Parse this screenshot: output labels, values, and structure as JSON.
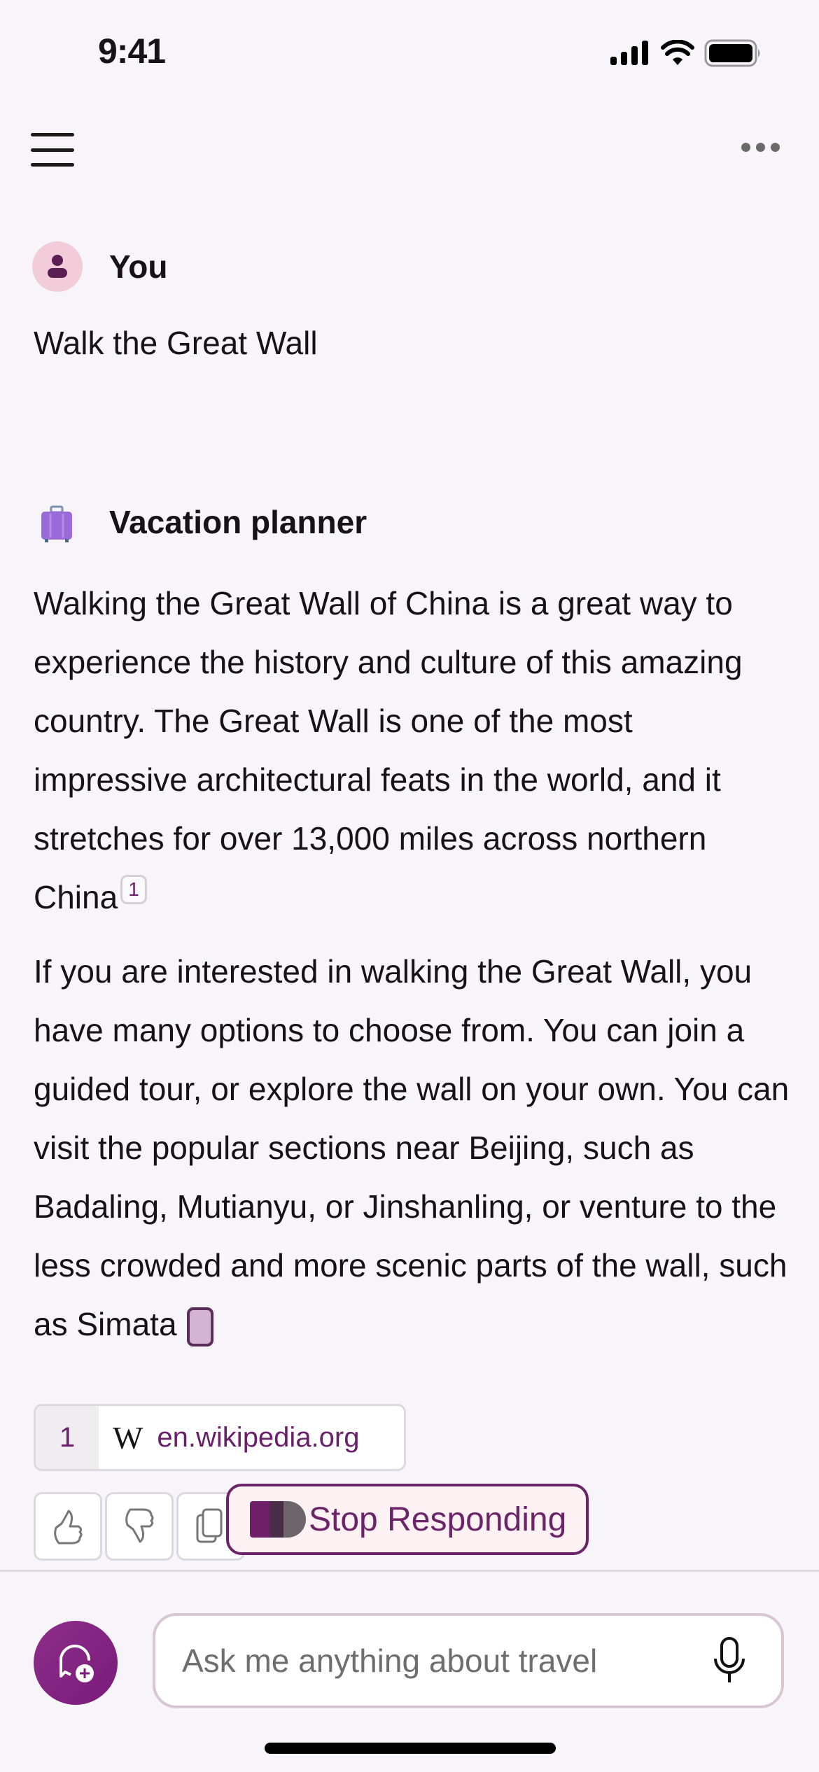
{
  "status_bar": {
    "time": "9:41"
  },
  "header": {
    "menu_icon": "hamburger-menu-icon",
    "more_icon": "more-horizontal-icon"
  },
  "conversation": {
    "user_message": {
      "sender": "You",
      "avatar_icon": "person-icon",
      "text": "Walk the Great Wall"
    },
    "assistant_message": {
      "sender": "Vacation planner",
      "avatar_icon": "suitcase-icon",
      "paragraphs": [
        {
          "text": "Walking the Great Wall of China is a great way to experience the history and culture of this amazing country. The Great Wall is one of the most impressive architectural feats in the world, and it stretches for over 13,000 miles across northern China",
          "citation": "1"
        },
        {
          "text": "If you are interested in walking the Great Wall, you have many options to choose from. You can join a guided tour, or explore the wall on your own. You can visit the popular sections near Beijing, such as Badaling, Mutianyu, or Jinshanling, or venture to the less crowded and more scenic parts of the wall, such as Simata"
        }
      ],
      "sources": [
        {
          "index": "1",
          "icon": "wikipedia-icon",
          "domain": "en.wikipedia.org"
        }
      ]
    }
  },
  "actions": {
    "thumbs_up_icon": "thumbs-up-icon",
    "thumbs_down_icon": "thumbs-down-icon",
    "copy_icon": "copy-icon",
    "stop_label": "Stop Responding"
  },
  "composer": {
    "placeholder": "Ask me anything about travel",
    "value": ""
  },
  "colors": {
    "accent": "#6a2467",
    "background": "#f7f5f9",
    "avatar_bg": "#f2ccd8"
  }
}
